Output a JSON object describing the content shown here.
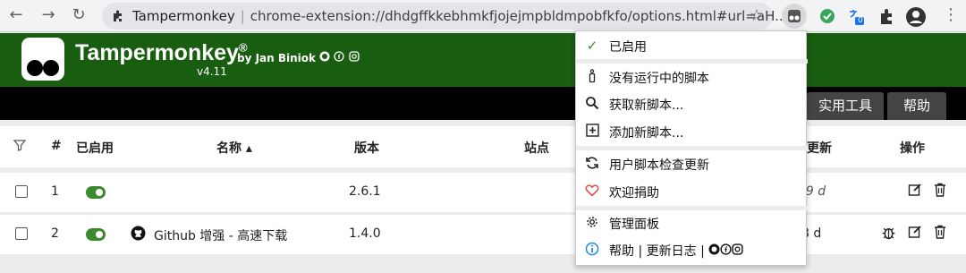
{
  "browser": {
    "omnibox_site": "Tampermonkey",
    "omnibox_url": "chrome-extension://dhdgffkkebhmkfjojejmpbldmpobfkfo/options.html#url=aH...",
    "extension_badge": "0"
  },
  "header": {
    "title": "Tampermonkey",
    "trademark": "®",
    "byline": "by Jan Biniok",
    "version": "v4.11"
  },
  "tabs": [
    {
      "label": "实用工具"
    },
    {
      "label": "帮助"
    }
  ],
  "table": {
    "headers": {
      "num": "#",
      "enabled": "已启用",
      "name": "名称 ▴",
      "version": "版本",
      "site": "站点",
      "updated": "更新",
      "actions": "操作"
    },
    "rows": [
      {
        "num": "1",
        "name": "",
        "version": "2.6.1",
        "updated": "59 d"
      },
      {
        "num": "2",
        "name": "Github 增强 - 高速下载",
        "version": "1.4.0",
        "updated": "8 d"
      }
    ]
  },
  "menu": {
    "items": [
      {
        "label": "已启用",
        "icon": "check-icon"
      },
      {
        "label": "没有运行中的脚本",
        "icon": "info-i-icon"
      },
      {
        "label": "获取新脚本...",
        "icon": "search-icon"
      },
      {
        "label": "添加新脚本...",
        "icon": "plus-square-icon"
      },
      {
        "label": "用户脚本检查更新",
        "icon": "refresh-icon"
      },
      {
        "label": "欢迎捐助",
        "icon": "heart-icon"
      },
      {
        "label": "管理面板",
        "icon": "gear-icon"
      },
      {
        "label": "帮助 | 更新日志 |",
        "icon": "info-circle-icon"
      }
    ]
  },
  "colors": {
    "header_bg": "#185d10",
    "toggle_on": "#3c8a2e",
    "tab_bg": "#444444"
  }
}
